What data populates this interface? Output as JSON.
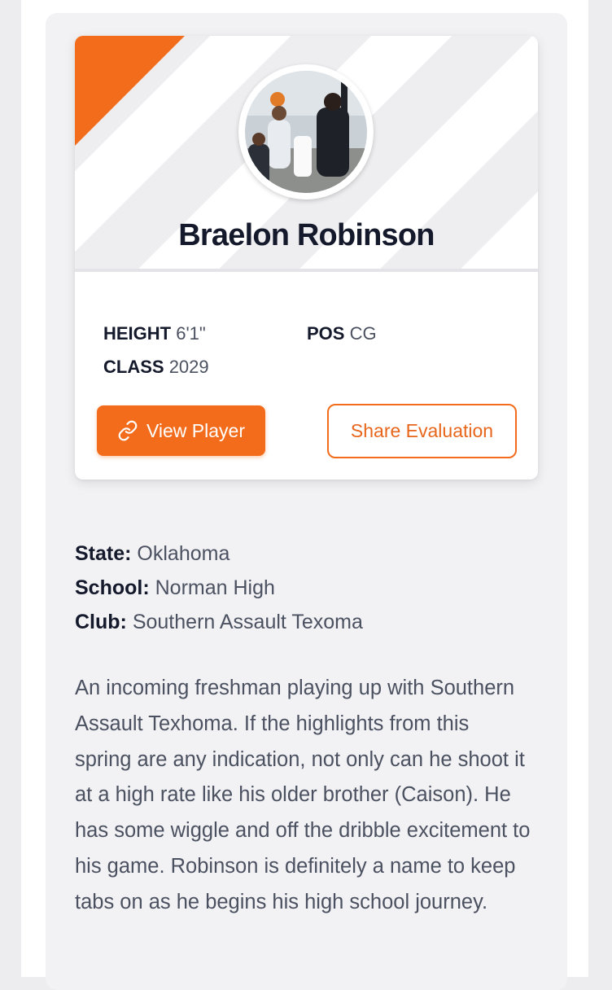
{
  "player": {
    "name": "Braelon Robinson",
    "height_label": "HEIGHT",
    "height_value": "6'1\"",
    "position_label": "POS",
    "position_value": "CG",
    "class_label": "CLASS",
    "class_value": "2029",
    "photo_icon": "player-photo"
  },
  "actions": {
    "view_label": "View Player",
    "view_icon": "link-icon",
    "share_label": "Share Evaluation"
  },
  "details": {
    "state_label": "State:",
    "state_value": "Oklahoma",
    "school_label": "School:",
    "school_value": "Norman High",
    "club_label": "Club:",
    "club_value": "Southern Assault Texoma"
  },
  "evaluation": "An incoming freshman playing up with Southern Assault Texhoma. If the highlights from this spring are any indication, not only can he shoot it at a high rate like his older brother (Caison). He has some wiggle and off the dribble excitement to his game. Robinson is definitely a name to keep tabs on as he begins his high school journey.",
  "colors": {
    "accent": "#f26c1c",
    "text_dark": "#14192b",
    "text_body": "#4b5160"
  }
}
